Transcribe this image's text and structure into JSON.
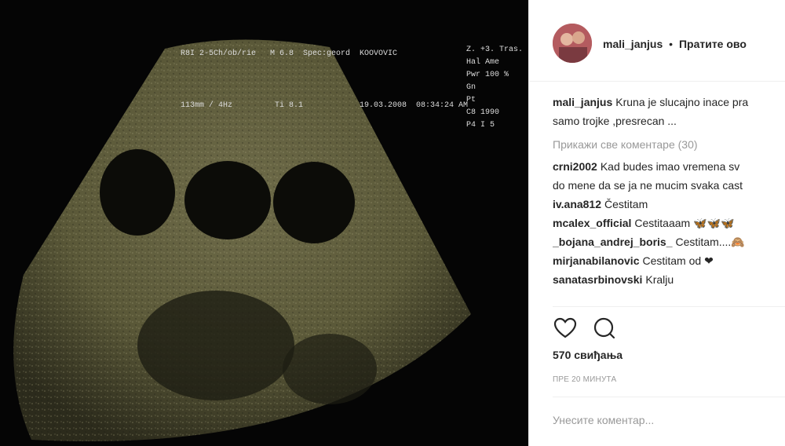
{
  "post": {
    "username": "mali_janjus",
    "separator": "•",
    "follow_label": "Пратите ово"
  },
  "photo": {
    "alt_text_lines": [
      "R8I 2-5Ch/ob/rie   M 6.8  Spec:geord  KOOVOVIC",
      "113mm / 4Hz         Ti 8.1            19.03.2008  08:34:24 AM"
    ],
    "side_text": [
      "Z. +3. Tras.",
      "Hal Ame",
      "Pwr 100 %",
      "Gn",
      "Pt",
      "C8 1990",
      "P4 I 5"
    ]
  },
  "caption": {
    "user": "mali_janjus",
    "text_line1": "Kruna je slucajno inace pra",
    "text_line2": "samo trojke ,presrecan ..."
  },
  "view_all_label": "Прикажи све коментаре (30)",
  "comments": [
    {
      "user": "crni2002",
      "text": "Kad budes imao vremena sv",
      "text2": "do mene da se ja ne mucim svaka cast"
    },
    {
      "user": "iv.ana812",
      "text": "Čestitam"
    },
    {
      "user": "mcalex_official",
      "text": "Cestitaaam 🦋🦋🦋"
    },
    {
      "user": "_bojana_andrej_boris_",
      "text": "Cestitam....🙈"
    },
    {
      "user": "mirjanabilanovic",
      "text": "Cestitam od ❤"
    },
    {
      "user": "sanatasrbinovski",
      "text": "Kralju"
    }
  ],
  "likes_label": "570 свиђања",
  "timestamp": "ПРЕ 20 МИНУТА",
  "comment_placeholder": "Унесите коментар..."
}
